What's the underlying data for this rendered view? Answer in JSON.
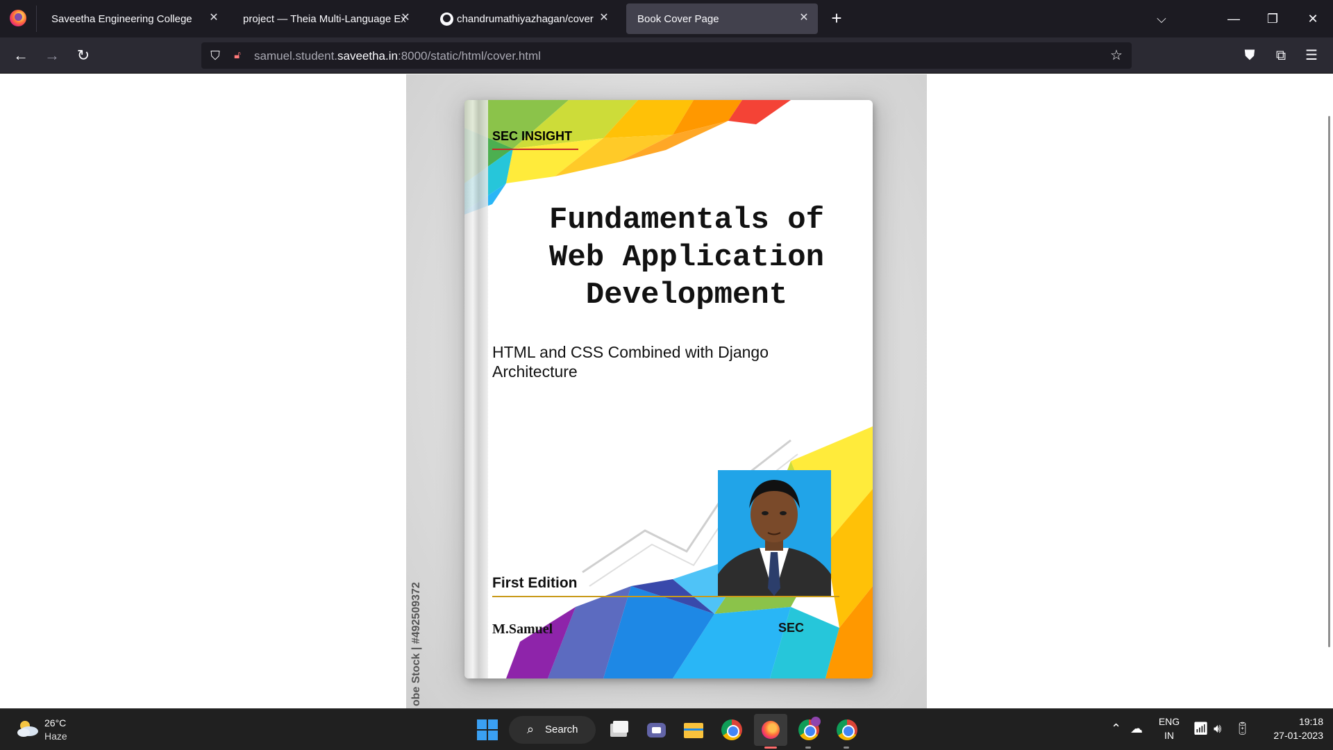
{
  "browser": {
    "tabs": [
      {
        "title": "Saveetha Engineering College",
        "active": false
      },
      {
        "title": "project — Theia Multi-Language Ex",
        "active": false
      },
      {
        "title": "chandrumathiyazhagan/cover",
        "active": false
      },
      {
        "title": "Book Cover Page",
        "active": true
      }
    ],
    "url": {
      "prefix": "samuel.student.",
      "domain": "saveetha.in",
      "suffix": ":8000/static/html/cover.html"
    }
  },
  "book": {
    "series": "SEC INSIGHT",
    "title_lines": [
      "Fundamentals of",
      "Web Application",
      "Development"
    ],
    "subtitle": "HTML and CSS Combined with Django Architecture",
    "edition": "First Edition",
    "author": "M.Samuel",
    "publisher": "SEC",
    "stock_id": "obe Stock | #492509372"
  },
  "taskbar": {
    "weather_temp": "26°C",
    "weather_desc": "Haze",
    "search_label": "Search",
    "lang_1": "ENG",
    "lang_2": "IN",
    "time": "19:18",
    "date": "27-01-2023"
  },
  "colors": {
    "tab_bar": "#1c1b22",
    "nav_bar": "#2b2a33",
    "active_tab": "#42414d",
    "taskbar": "#202020",
    "series_rule": "#c62828",
    "edition_rule": "#c99a1a",
    "photo_bg": "#21a4e8"
  },
  "icons": {
    "nav": [
      "back-arrow-icon",
      "forward-arrow-icon",
      "reload-icon"
    ],
    "url": [
      "shield-icon",
      "lock-warning-icon",
      "star-icon"
    ],
    "toolbar": [
      "pocket-icon",
      "extensions-icon",
      "menu-icon"
    ]
  }
}
